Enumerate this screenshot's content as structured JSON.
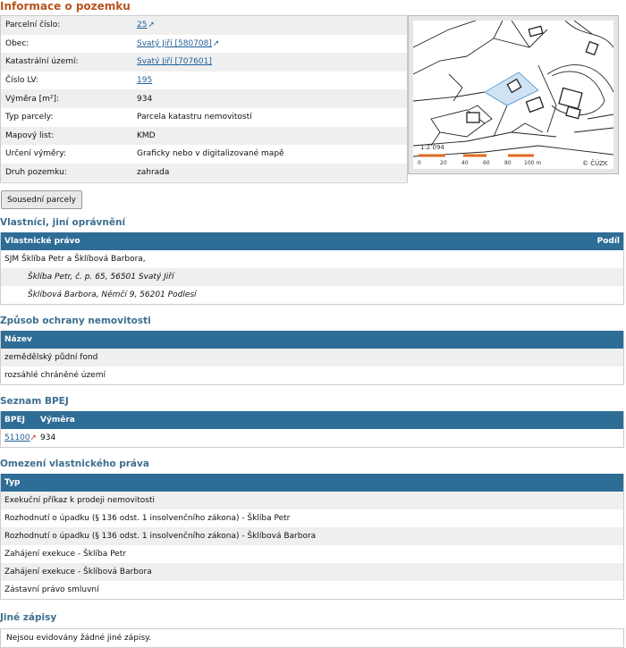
{
  "page_title": "Informace o pozemku",
  "parcel_info": [
    {
      "label": "Parcelní číslo:",
      "value": "25",
      "link": true,
      "ext": true
    },
    {
      "label": "Obec:",
      "value": "Svatý Jiří [580708]",
      "link": true,
      "ext": true
    },
    {
      "label": "Katastrální území:",
      "value": "Svatý Jiří [707601]",
      "link": true,
      "ext": false
    },
    {
      "label": "Číslo LV:",
      "value": "195",
      "link": true,
      "ext": false
    },
    {
      "label": "Výměra [m²]:",
      "value": "934",
      "link": false,
      "ext": false
    },
    {
      "label": "Typ parcely:",
      "value": "Parcela katastru nemovitostí",
      "link": false,
      "ext": false
    },
    {
      "label": "Mapový list:",
      "value": "KMD",
      "link": false,
      "ext": false
    },
    {
      "label": "Určení výměry:",
      "value": "Graficky nebo v digitalizované mapě",
      "link": false,
      "ext": false
    },
    {
      "label": "Druh pozemku:",
      "value": "zahrada",
      "link": false,
      "ext": false
    }
  ],
  "map": {
    "scale_label": "1:2 094",
    "copyright": "© ČÚZK",
    "scale_ticks": [
      "0",
      "20",
      "40",
      "60",
      "80",
      "100 m"
    ],
    "highlight_color": "#cfe3f5"
  },
  "neighbors_button": "Sousední parcely",
  "owners": {
    "title": "Vlastníci, jiní oprávnění",
    "header_left": "Vlastnické právo",
    "header_right": "Podíl",
    "rows": [
      "SJM Šklíba Petr a Šklíbová Barbora,",
      "Šklíba Petr, č. p. 65, 56501 Svatý Jiří",
      "Šklíbová Barbora, Němčí 9, 56201 Podlesí"
    ]
  },
  "protection": {
    "title": "Způsob ochrany nemovitosti",
    "header": "Název",
    "rows": [
      "zemědělský půdní fond",
      "rozsáhlé chráněné území"
    ]
  },
  "bpej": {
    "title": "Seznam BPEJ",
    "col1": "BPEJ",
    "col2": "Výměra",
    "code": "51100",
    "area": "934"
  },
  "restrictions": {
    "title": "Omezení vlastnického práva",
    "header": "Typ",
    "rows": [
      "Exekuční příkaz k prodeji nemovitosti",
      "Rozhodnutí o úpadku (§ 136 odst. 1 insolvenčního zákona) - Šklíba Petr",
      "Rozhodnutí o úpadku (§ 136 odst. 1 insolvenčního zákona) - Šklíbová Barbora",
      "Zahájení exekuce - Šklíba Petr",
      "Zahájení exekuce - Šklíbová Barbora",
      "Zástavní právo smluvní"
    ]
  },
  "other": {
    "title": "Jiné zápisy",
    "text": "Nejsou evidovány žádné jiné zápisy."
  }
}
